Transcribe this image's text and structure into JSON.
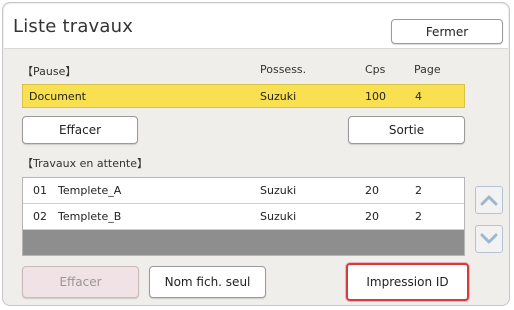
{
  "title": "Liste travaux",
  "close_label": "Fermer",
  "paused": {
    "section_label": "【Pause】",
    "columns": {
      "owner": "Possess.",
      "copies": "Cps",
      "pages": "Page"
    },
    "row": {
      "name": "Document",
      "owner": "Suzuki",
      "copies": "100",
      "pages": "4"
    }
  },
  "paused_actions": {
    "delete_label": "Effacer",
    "output_label": "Sortie"
  },
  "waiting": {
    "section_label": "【Travaux en attente】",
    "rows": [
      {
        "no": "01",
        "name": "Templete_A",
        "owner": "Suzuki",
        "copies": "20",
        "pages": "2"
      },
      {
        "no": "02",
        "name": "Templete_B",
        "owner": "Suzuki",
        "copies": "20",
        "pages": "2"
      }
    ]
  },
  "bottom_actions": {
    "delete_label": "Effacer",
    "filename_only_label": "Nom fich. seul",
    "print_id_label": "Impression ID"
  },
  "icons": {
    "scroll_up": "chevron-up-icon",
    "scroll_down": "chevron-down-icon"
  },
  "colors": {
    "highlight_row": "#f9e051",
    "highlight_border": "#d9393f",
    "arrow_blue": "#9fb6cf"
  }
}
